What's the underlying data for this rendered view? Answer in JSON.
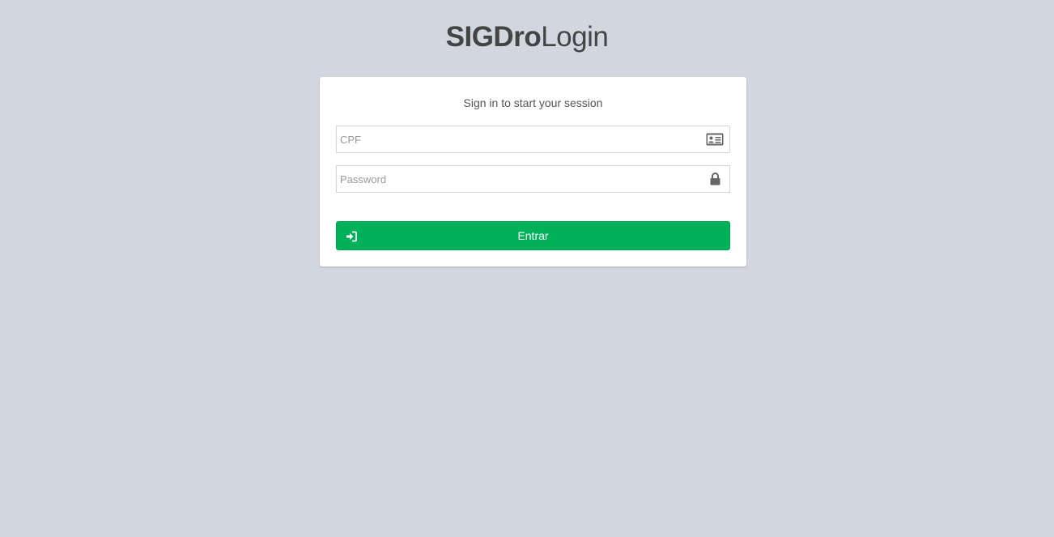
{
  "logo": {
    "bold": "SIGDro",
    "light": "Login"
  },
  "login": {
    "message": "Sign in to start your session",
    "cpf": {
      "placeholder": "CPF",
      "value": "",
      "icon": "id-card-icon"
    },
    "password": {
      "placeholder": "Password",
      "value": "",
      "icon": "lock-icon"
    },
    "submit": {
      "label": "Entrar",
      "icon": "sign-in-icon"
    }
  },
  "colors": {
    "background": "#d2d6de",
    "box": "#ffffff",
    "button": "#00b159",
    "text": "#444444",
    "icon": "#666666"
  }
}
